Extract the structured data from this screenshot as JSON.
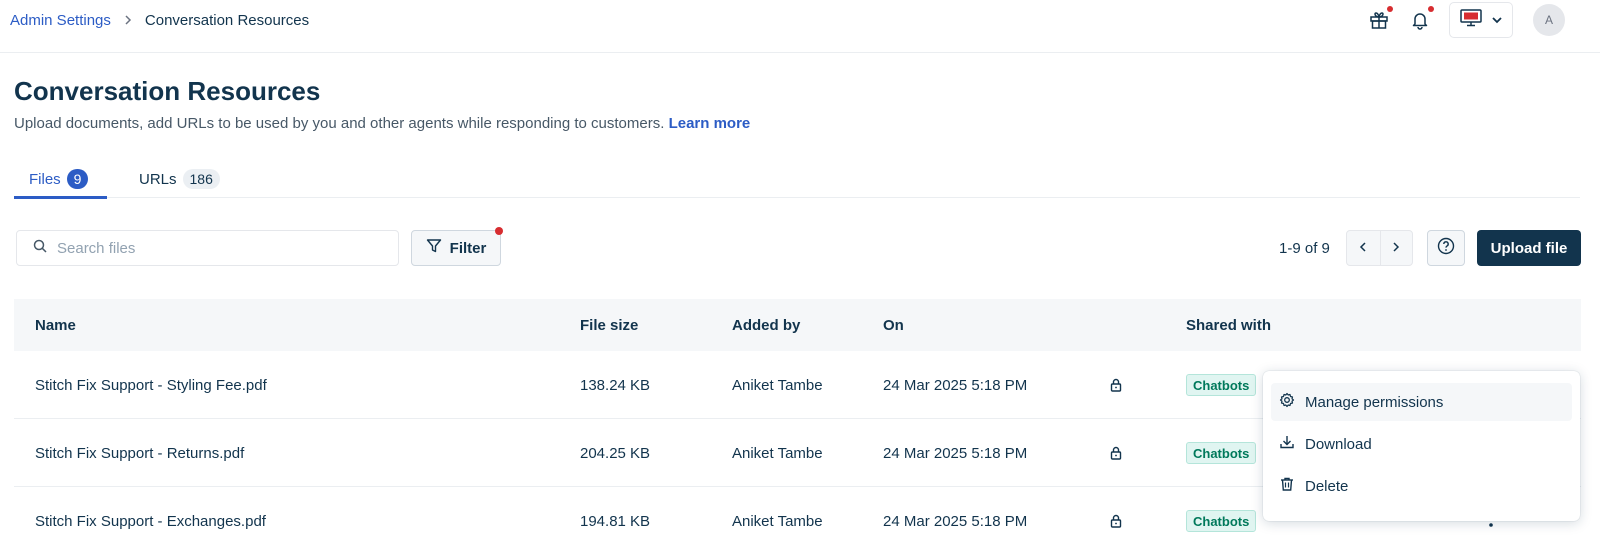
{
  "breadcrumb": {
    "parent": "Admin Settings",
    "current": "Conversation Resources"
  },
  "topbar": {
    "icons": [
      "gift-icon",
      "bell-icon",
      "monitor-icon",
      "chevron-down-icon"
    ],
    "avatar_initial": "A",
    "notification_color": "#d72d30"
  },
  "header": {
    "title": "Conversation Resources",
    "subtitle": "Upload documents, add URLs to be used by you and other agents while responding to customers.",
    "learn_more": "Learn more"
  },
  "tabs": [
    {
      "label": "Files",
      "count": "9",
      "active": true
    },
    {
      "label": "URLs",
      "count": "186",
      "active": false
    }
  ],
  "toolbar": {
    "search_placeholder": "Search files",
    "filter_label": "Filter",
    "pagination": "1-9 of 9",
    "upload_label": "Upload file"
  },
  "table": {
    "columns": [
      "Name",
      "File size",
      "Added by",
      "On",
      "Shared with"
    ],
    "rows": [
      {
        "name": "Stitch Fix Support - Styling Fee.pdf",
        "size": "138.24 KB",
        "added_by": "Aniket Tambe",
        "on": "24 Mar 2025 5:18 PM",
        "shared": "Chatbots"
      },
      {
        "name": "Stitch Fix Support - Returns.pdf",
        "size": "204.25 KB",
        "added_by": "Aniket Tambe",
        "on": "24 Mar 2025 5:18 PM",
        "shared": "Chatbots"
      },
      {
        "name": "Stitch Fix Support - Exchanges.pdf",
        "size": "194.81 KB",
        "added_by": "Aniket Tambe",
        "on": "24 Mar 2025 5:18 PM",
        "shared": "Chatbots"
      }
    ]
  },
  "menu": {
    "items": [
      {
        "label": "Manage permissions",
        "icon": "gear-icon"
      },
      {
        "label": "Download",
        "icon": "download-icon"
      },
      {
        "label": "Delete",
        "icon": "trash-icon"
      }
    ]
  },
  "colors": {
    "primary": "#2c5cc5",
    "dark": "#12344d",
    "badge_text": "#00795b"
  }
}
